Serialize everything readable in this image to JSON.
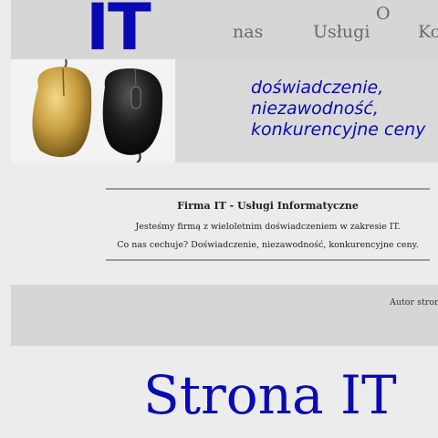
{
  "header": {
    "logo": "IT",
    "nav": {
      "about_top": "O",
      "about_bottom": "nas",
      "services": "Usługi",
      "contact": "Ko"
    }
  },
  "banner": {
    "image_alt": "mouse-photo",
    "slogan": [
      "doświadczenie,",
      "niezawodność,",
      "konkurencyjne ceny"
    ]
  },
  "article": {
    "title": "Firma IT - Usługi Informatyczne",
    "paragraph1": "Jesteśmy firmą z wieloletnim doświadczeniem w zakresie IT.",
    "paragraph2": "Co nas cechuje? Doświadczenie, niezawodność, konkurencyjne ceny."
  },
  "footer": {
    "author": "Autor strony"
  },
  "page_title": "Strona IT",
  "colors": {
    "brand_blue": "#0a0ab4",
    "header_bg": "#d6d6d6",
    "page_bg": "#ececec"
  }
}
